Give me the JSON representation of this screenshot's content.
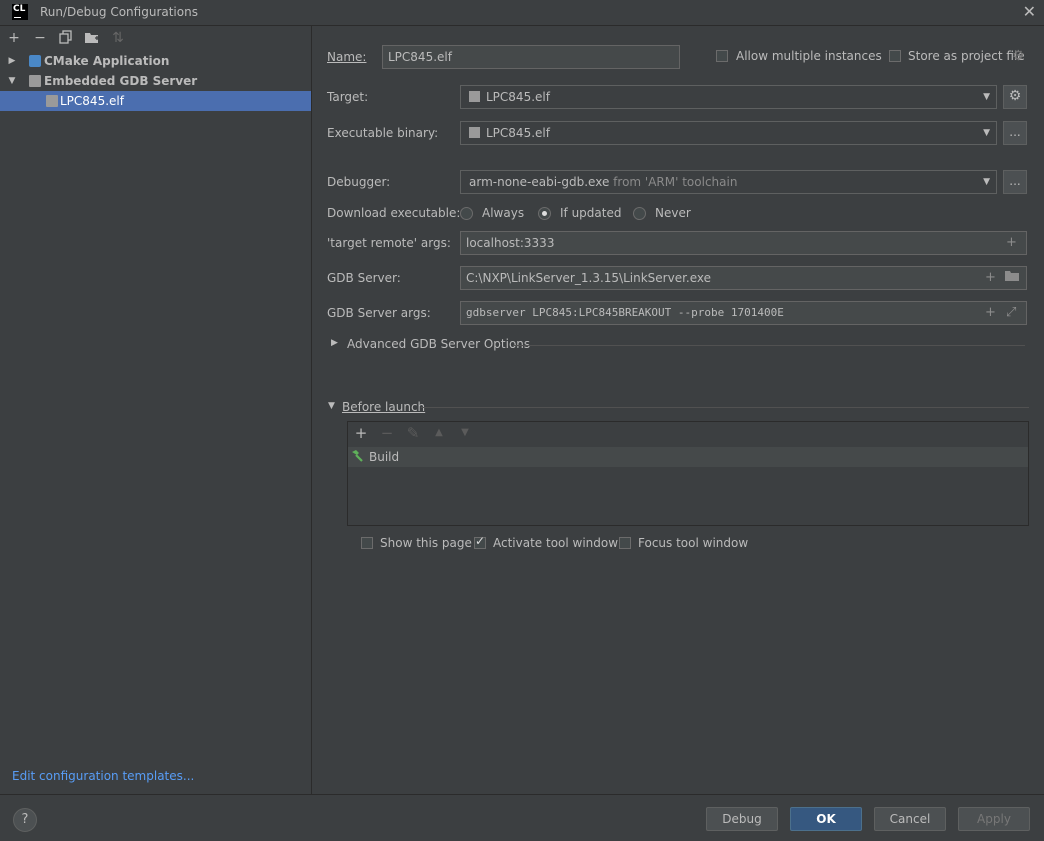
{
  "window": {
    "logo": "CL",
    "title": "Run/Debug Configurations"
  },
  "tree": {
    "items": [
      {
        "label": "CMake Application"
      },
      {
        "label": "Embedded GDB Server"
      },
      {
        "label": "LPC845.elf"
      }
    ],
    "edit_templates": "Edit configuration templates..."
  },
  "form": {
    "name_label": "Name:",
    "name_value": "LPC845.elf",
    "allow_multiple": "Allow multiple instances",
    "store_project": "Store as project file",
    "target_label": "Target:",
    "target_value": "LPC845.elf",
    "exec_label": "Executable binary:",
    "exec_value": "LPC845.elf",
    "debugger_label": "Debugger:",
    "debugger_value": "arm-none-eabi-gdb.exe",
    "debugger_suffix": "from 'ARM' toolchain",
    "download_label": "Download executable:",
    "download_options": [
      "Always",
      "If updated",
      "Never"
    ],
    "download_selected": "If updated",
    "remote_label": "'target remote' args:",
    "remote_value": "localhost:3333",
    "gdbserver_label": "GDB Server:",
    "gdbserver_value": "C:\\NXP\\LinkServer_1.3.15\\LinkServer.exe",
    "gdbargs_label": "GDB Server args:",
    "gdbargs_value": "gdbserver LPC845:LPC845BREAKOUT --probe 1701400E",
    "advanced_label": "Advanced GDB Server Options",
    "dots": "..."
  },
  "before_launch": {
    "label": "Before launch",
    "tasks": [
      "Build"
    ],
    "show_page": "Show this page",
    "activate_tool": "Activate tool window",
    "focus_tool": "Focus tool window",
    "activate_checked": true
  },
  "buttons": {
    "help": "?",
    "debug": "Debug",
    "ok": "OK",
    "cancel": "Cancel",
    "apply": "Apply"
  },
  "colors": {
    "accent": "#4b6eaf",
    "primary_button": "#365880",
    "link": "#589df6",
    "build_icon": "#5fb05a"
  }
}
